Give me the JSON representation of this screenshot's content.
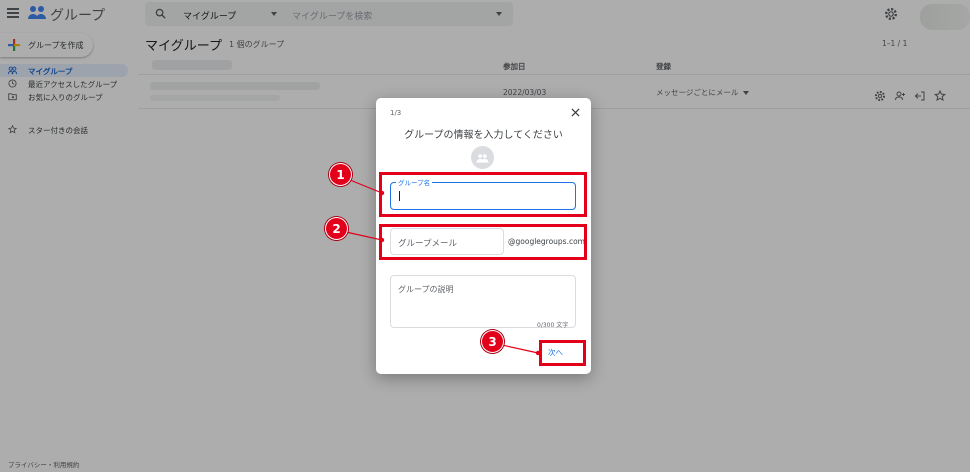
{
  "app": {
    "title": "グループ",
    "create_label": "グループを作成",
    "footer": "プライバシー・利用規約"
  },
  "search": {
    "scope": "マイグループ",
    "placeholder": "マイグループを検索"
  },
  "nav": {
    "items": [
      {
        "label": "マイグループ",
        "active": true
      },
      {
        "label": "最近アクセスしたグループ",
        "active": false
      },
      {
        "label": "お気に入りのグループ",
        "active": false
      }
    ],
    "starred": "スター付きの会話"
  },
  "main": {
    "title": "マイグループ",
    "count": "1 個のグループ",
    "pager": "1–1 / 1",
    "columns": {
      "joined": "参加日",
      "subscription": "登録"
    },
    "row": {
      "date": "2022/03/03",
      "subscription": "メッセージごとにメール"
    }
  },
  "dialog": {
    "step": "1/3",
    "title": "グループの情報を入力してください",
    "name_label": "グループ名",
    "email_placeholder": "グループメール",
    "email_suffix": "@googlegroups.com",
    "description_placeholder": "グループの説明",
    "char_count": "0/300 文字",
    "next_label": "次へ"
  },
  "annotations": {
    "badges": [
      "1",
      "2",
      "3"
    ],
    "color": "#e2001a"
  },
  "colors": {
    "accent": "#1a73e8",
    "annotation": "#e2001a"
  }
}
